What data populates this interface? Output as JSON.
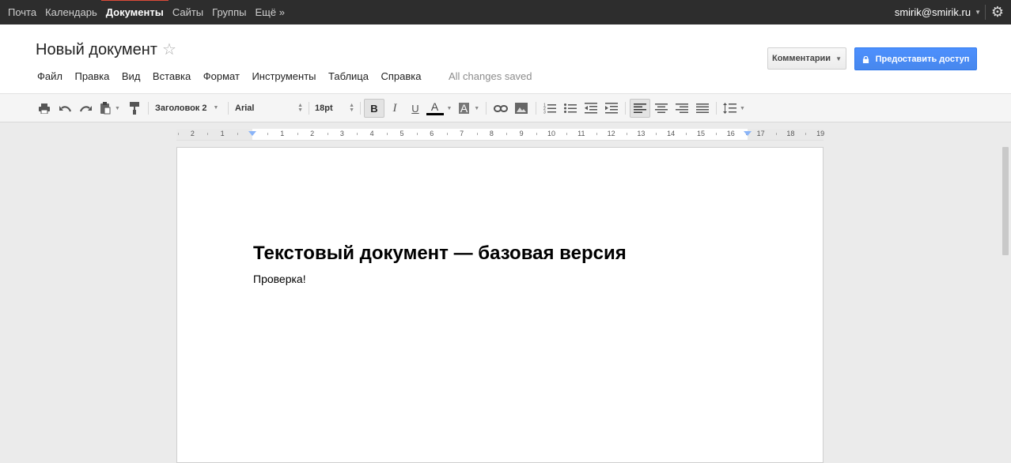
{
  "topbar": {
    "nav": [
      {
        "label": "Почта",
        "active": false
      },
      {
        "label": "Календарь",
        "active": false
      },
      {
        "label": "Документы",
        "active": true
      },
      {
        "label": "Сайты",
        "active": false
      },
      {
        "label": "Группы",
        "active": false
      },
      {
        "label": "Ещё »",
        "active": false
      }
    ],
    "account": "smirik@smirik.ru"
  },
  "document": {
    "title": "Новый документ",
    "save_status": "All changes saved",
    "heading": "Текстовый документ — базовая версия",
    "body": "Проверка!"
  },
  "menu": [
    "Файл",
    "Правка",
    "Вид",
    "Вставка",
    "Формат",
    "Инструменты",
    "Таблица",
    "Справка"
  ],
  "buttons": {
    "comments": "Комментарии",
    "share": "Предоставить доступ"
  },
  "toolbar": {
    "style": "Заголовок 2",
    "font": "Arial",
    "size": "18pt",
    "bold": "B",
    "italic": "I",
    "underline": "U",
    "text_color_letter": "A",
    "highlight_letter": "A",
    "icons": [
      "print-icon",
      "undo-icon",
      "redo-icon",
      "paste-icon",
      "paint-format-icon",
      "link-icon",
      "image-icon",
      "numbered-list-icon",
      "bulleted-list-icon",
      "decrease-indent-icon",
      "increase-indent-icon",
      "align-left-icon",
      "align-center-icon",
      "align-right-icon",
      "justify-icon",
      "line-spacing-icon"
    ],
    "active_alignment": "left",
    "bold_active": true
  },
  "ruler": {
    "labels": [
      "2",
      "1",
      "1",
      "2",
      "3",
      "4",
      "5",
      "6",
      "7",
      "8",
      "9",
      "10",
      "11",
      "12",
      "13",
      "14",
      "15",
      "16",
      "17",
      "18",
      "19"
    ]
  },
  "colors": {
    "topbar": "#2d2d2d",
    "active_tab_accent": "#dd4b39",
    "share_button": "#4d90fe",
    "text_color_swatch": "#000000"
  }
}
